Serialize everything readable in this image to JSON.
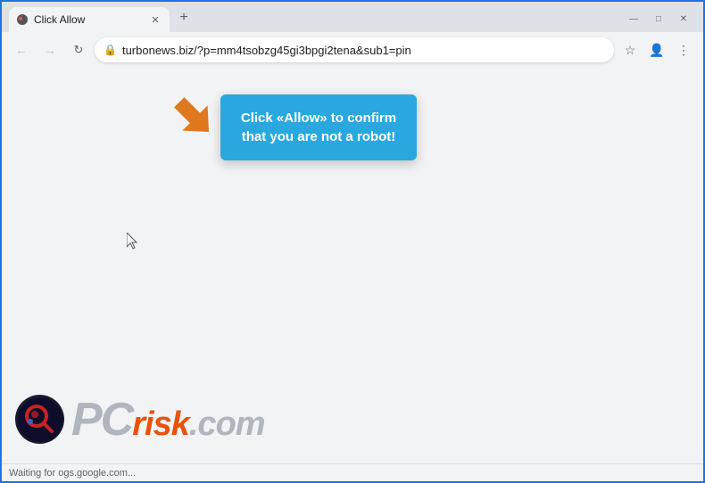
{
  "window": {
    "title": "Click Allow",
    "border_color": "#1a73e8"
  },
  "titlebar": {
    "tab_label": "Click Allow",
    "new_tab_icon": "+",
    "minimize_icon": "—",
    "maximize_icon": "□",
    "close_icon": "✕"
  },
  "addressbar": {
    "url": "turbonews.biz/?p=mm4tsobzg45gi3bpgi2tena&sub1=pin",
    "back_icon": "←",
    "forward_icon": "→",
    "refresh_icon": "↻",
    "lock_icon": "🔒",
    "bookmark_icon": "☆",
    "profile_icon": "👤",
    "menu_icon": "⋮"
  },
  "balloon": {
    "text": "Click «Allow» to confirm that you are not a robot!"
  },
  "statusbar": {
    "text": "Waiting for ogs.google.com..."
  },
  "pcrisk": {
    "pc": "PC",
    "risk": "risk",
    "dotcom": ".com"
  }
}
